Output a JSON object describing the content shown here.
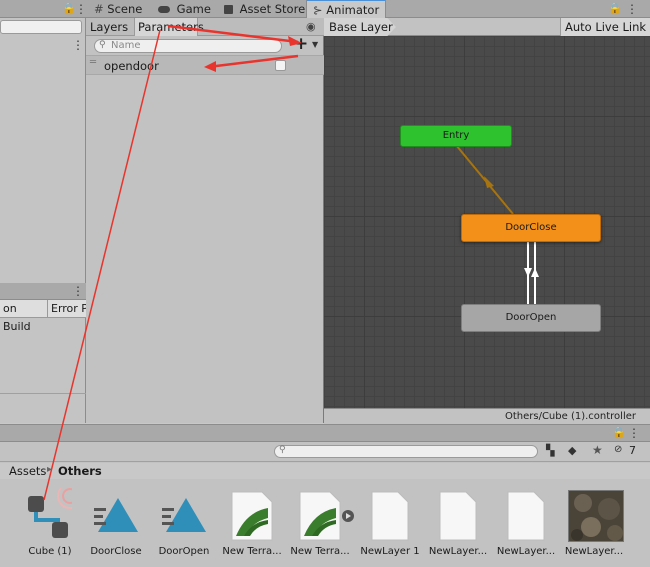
{
  "left_panel": {
    "build_label": "on Build",
    "error_label": "Error P"
  },
  "tabs": [
    {
      "label": "Scene"
    },
    {
      "label": "Game"
    },
    {
      "label": "Asset Store"
    },
    {
      "label": "Animator"
    }
  ],
  "params": {
    "tab_layers": "Layers",
    "tab_parameters": "Parameters",
    "search_placeholder": "Name",
    "add_symbol": "+",
    "parameter_name": "opendoor"
  },
  "animator": {
    "breadcrumb": "Base Layer",
    "auto_live_link": "Auto Live Link",
    "status_path": "Others/Cube (1).controller",
    "nodes": [
      {
        "label": "Entry",
        "color": "#2ec22e"
      },
      {
        "label": "DoorClose",
        "color": "#f2901a"
      },
      {
        "label": "DoorOpen",
        "color": "#a6a6a6"
      }
    ]
  },
  "project": {
    "breadcrumb_root": "Assets",
    "breadcrumb_current": "Others",
    "visibility_count": "7",
    "assets": [
      {
        "label": "Cube (1)"
      },
      {
        "label": "DoorClose"
      },
      {
        "label": "DoorOpen"
      },
      {
        "label": "New Terra..."
      },
      {
        "label": "New Terra..."
      },
      {
        "label": "NewLayer 1"
      },
      {
        "label": "NewLayer..."
      },
      {
        "label": "NewLayer..."
      },
      {
        "label": "NewLayer..."
      }
    ]
  },
  "colors": {
    "accent_arrow": "#e8342c",
    "selected_tab": "#4a90d9"
  }
}
